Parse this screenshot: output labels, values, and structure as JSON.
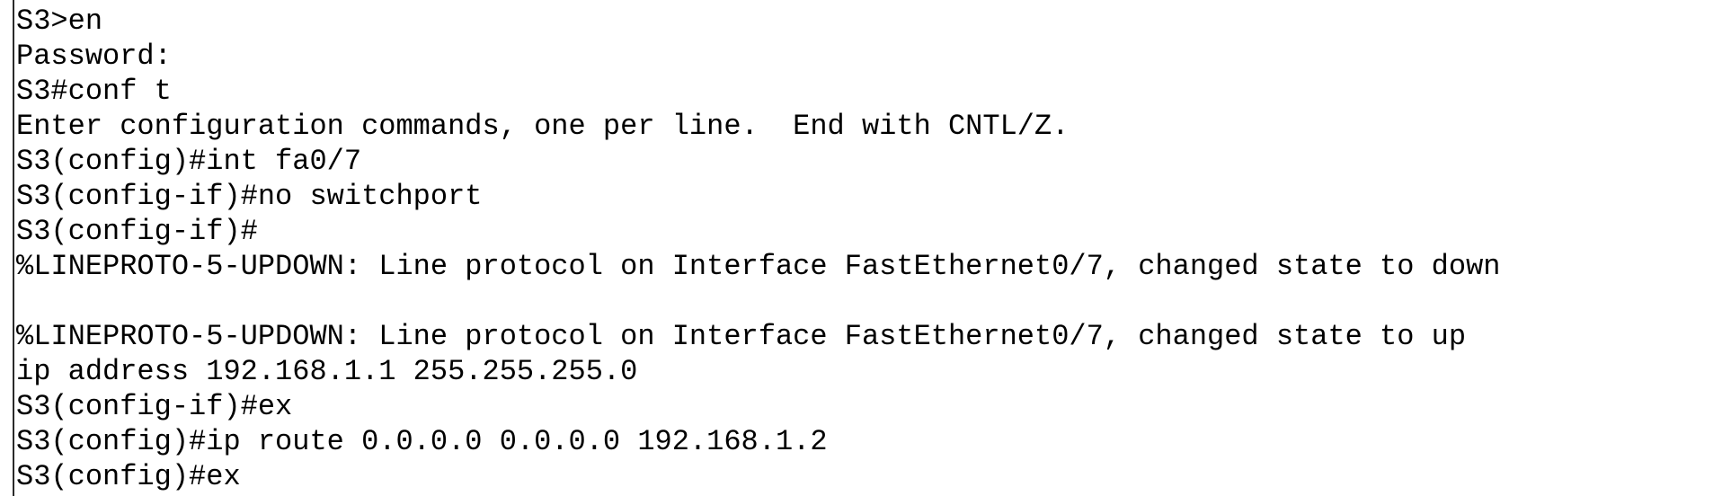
{
  "terminal": {
    "lines": [
      "S3>en",
      "Password:",
      "S3#conf t",
      "Enter configuration commands, one per line.  End with CNTL/Z.",
      "S3(config)#int fa0/7",
      "S3(config-if)#no switchport",
      "S3(config-if)#",
      "%LINEPROTO-5-UPDOWN: Line protocol on Interface FastEthernet0/7, changed state to down",
      "",
      "%LINEPROTO-5-UPDOWN: Line protocol on Interface FastEthernet0/7, changed state to up",
      "ip address 192.168.1.1 255.255.255.0",
      "S3(config-if)#ex",
      "S3(config)#ip route 0.0.0.0 0.0.0.0 192.168.1.2",
      "S3(config)#ex"
    ]
  }
}
